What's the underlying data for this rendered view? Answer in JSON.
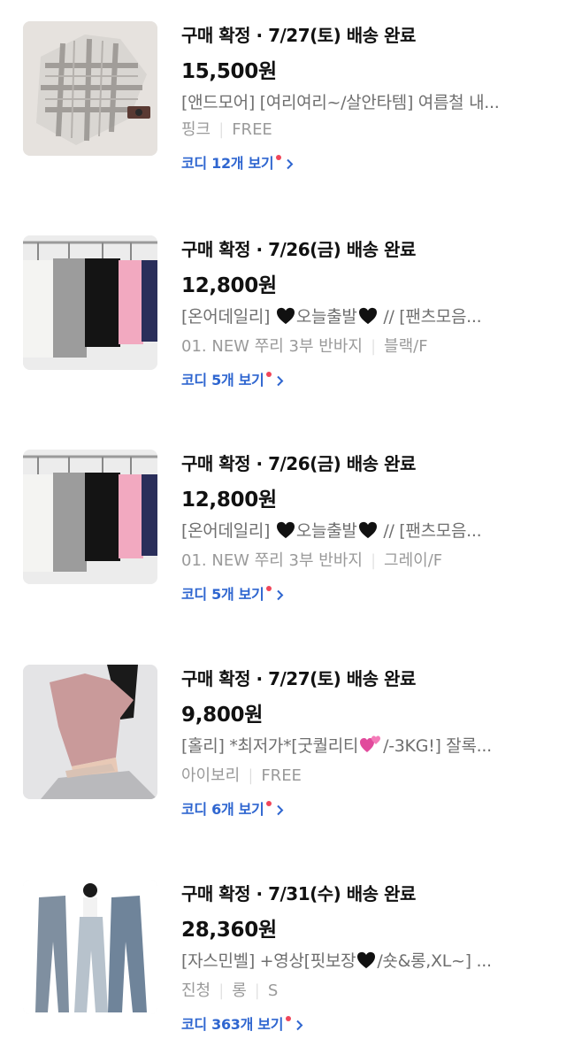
{
  "orders": [
    {
      "status": "구매 확정 · 7/27(토) 배송 완료",
      "price": "15,500원",
      "title_parts": [
        "[앤드모어] [여리여리~/살안타템] 여름철 내..."
      ],
      "option_parts": [
        "핑크",
        "FREE"
      ],
      "cody_label": "코디 12개 보기",
      "thumbnail": "plaid-shirt-image"
    },
    {
      "status": "구매 확정 · 7/26(금) 배송 완료",
      "price": "12,800원",
      "title_parts": [
        "[온어데일리] ",
        "오늘출발",
        " // [팬츠모음..."
      ],
      "option_parts": [
        "01. NEW 쭈리 3부 반바지",
        "블랙/F"
      ],
      "cody_label": "코디 5개 보기",
      "thumbnail": "shorts-rack-image"
    },
    {
      "status": "구매 확정 · 7/26(금) 배송 완료",
      "price": "12,800원",
      "title_parts": [
        "[온어데일리] ",
        "오늘출발",
        " // [팬츠모음..."
      ],
      "option_parts": [
        "01. NEW 쭈리 3부 반바지",
        "그레이/F"
      ],
      "cody_label": "코디 5개 보기",
      "thumbnail": "shorts-rack-image"
    },
    {
      "status": "구매 확정 · 7/27(토) 배송 완료",
      "price": "9,800원",
      "title_parts": [
        "[홀리] *최저가*[굿퀄리티",
        "/-3KG!] 잘록..."
      ],
      "option_parts": [
        "아이보리",
        "FREE"
      ],
      "cody_label": "코디 6개 보기",
      "thumbnail": "pink-tee-model-image"
    },
    {
      "status": "구매 확정 · 7/31(수) 배송 완료",
      "price": "28,360원",
      "title_parts": [
        "[자스민벨] +영상[핏보장",
        "/숏&롱,XL~] ..."
      ],
      "option_parts": [
        "진청",
        "롱",
        "S"
      ],
      "cody_label": "코디 363개 보기",
      "thumbnail": "denim-wide-pants-image"
    }
  ],
  "colors": {
    "link_blue": "#2f66d0",
    "new_dot": "#f0465a",
    "secondary_text": "#6f6f6f",
    "option_text": "#9a9a9a"
  }
}
